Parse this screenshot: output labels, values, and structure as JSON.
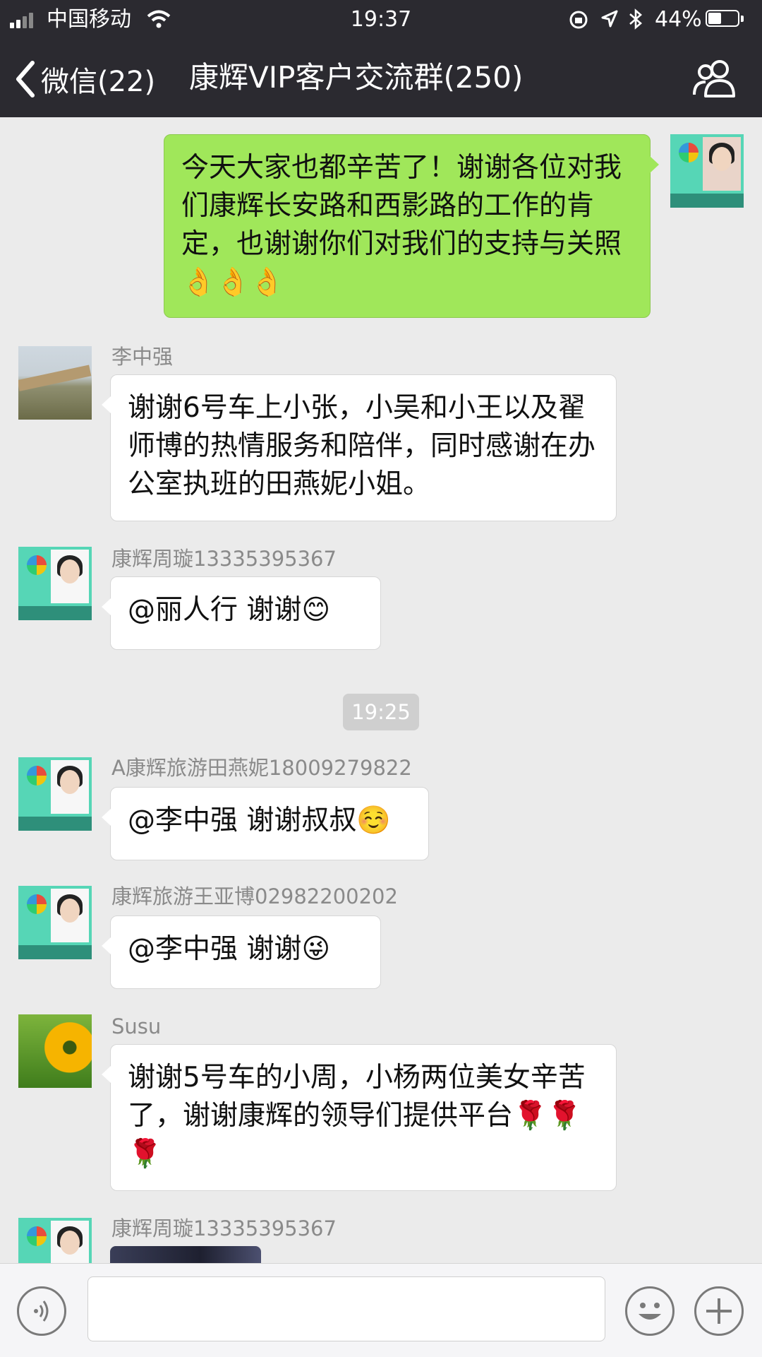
{
  "status_bar": {
    "carrier": "中国移动",
    "time": "19:37",
    "battery_percent": "44%",
    "icons": [
      "signal-icon",
      "wifi-icon",
      "rotation-lock-icon",
      "location-icon",
      "bluetooth-icon",
      "battery-icon"
    ]
  },
  "nav": {
    "back_label": "微信(22)",
    "title": "康辉VIP客户交流群(250)",
    "right_icon": "group-members-icon"
  },
  "messages": [
    {
      "direction": "out",
      "sender": "",
      "text": "今天大家也都辛苦了！谢谢各位对我们康辉长安路和西影路的工作的肯定，也谢谢你们对我们的支持与关照👌👌👌"
    },
    {
      "direction": "in",
      "sender": "李中强",
      "text": "谢谢6号车上小张，小吴和小王以及翟师博的热情服务和陪伴，同时感谢在办公室执班的田燕妮小姐。"
    },
    {
      "direction": "in",
      "sender": "康辉周璇13335395367",
      "text": "@丽人行 谢谢😊"
    },
    {
      "direction": "in",
      "sender": "A康辉旅游田燕妮18009279822",
      "text": "@李中强 谢谢叔叔☺️"
    },
    {
      "direction": "in",
      "sender": "康辉旅游王亚博02982200202",
      "text": "@李中强 谢谢😜"
    },
    {
      "direction": "in",
      "sender": "Susu",
      "text": "谢谢5号车的小周，小杨两位美女辛苦了，谢谢康辉的领导们提供平台🌹🌹🌹"
    },
    {
      "direction": "in",
      "sender": "康辉周璇13335395367",
      "text": "",
      "type": "image"
    }
  ],
  "timestamp": "19:25",
  "input_bar": {
    "placeholder": "",
    "icons": [
      "voice-icon",
      "emoji-icon",
      "plus-icon"
    ]
  },
  "colors": {
    "nav_background": "#2b2a30",
    "chat_background": "#ebebeb",
    "outgoing_bubble": "#a0e75a",
    "incoming_bubble": "#ffffff"
  }
}
